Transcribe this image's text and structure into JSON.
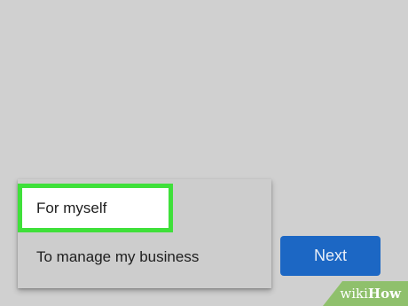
{
  "menu": {
    "items": [
      {
        "label": "For myself",
        "highlighted": true
      },
      {
        "label": "To manage my business",
        "highlighted": false
      }
    ]
  },
  "actions": {
    "next_label": "Next"
  },
  "watermark": {
    "wiki": "wiki",
    "how": "How"
  },
  "colors": {
    "background": "#d0d0d0",
    "highlight_border": "#3fe03a",
    "button_blue": "#1c67c4",
    "watermark_green": "#8fc06c"
  }
}
